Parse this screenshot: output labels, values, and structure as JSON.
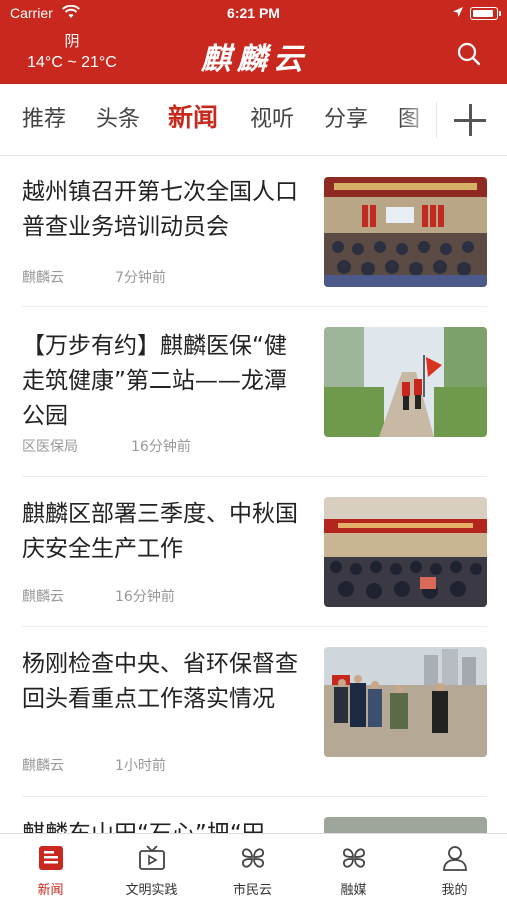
{
  "status_bar": {
    "carrier": "Carrier",
    "time": "6:21 PM"
  },
  "header": {
    "weather_condition": "阴",
    "weather_temp": "14°C ~ 21°C",
    "logo_text": "麒麟云"
  },
  "channels": [
    "推荐",
    "头条",
    "新闻",
    "视听",
    "分享",
    "图"
  ],
  "active_channel": "新闻",
  "feed": [
    {
      "title": "越州镇召开第七次全国人口普查业务培训动员会",
      "source": "麒麟云",
      "time": "7分钟前"
    },
    {
      "title": "【万步有约】麒麟医保“健走筑健康”第二站——龙潭公园",
      "source": "区医保局",
      "time": "16分钟前"
    },
    {
      "title": "麒麟区部署三季度、中秋国庆安全生产工作",
      "source": "麒麟云",
      "time": "16分钟前"
    },
    {
      "title": "杨刚检查中央、省环保督查回头看重点工作落实情况",
      "source": "麒麟云",
      "time": "1小时前"
    },
    {
      "title": "麒麟东山田“石心”把“田",
      "source": "",
      "time": ""
    }
  ],
  "tabbar": [
    {
      "label": "新闻",
      "icon": "news-icon",
      "active": true
    },
    {
      "label": "文明实践",
      "icon": "tv-icon",
      "active": false
    },
    {
      "label": "市民云",
      "icon": "clover-icon",
      "active": false
    },
    {
      "label": "融媒",
      "icon": "clover-icon",
      "active": false
    },
    {
      "label": "我的",
      "icon": "user-icon",
      "active": false
    }
  ],
  "colors": {
    "brand_red": "#c8281e",
    "text": "#222222",
    "meta": "#999999"
  }
}
